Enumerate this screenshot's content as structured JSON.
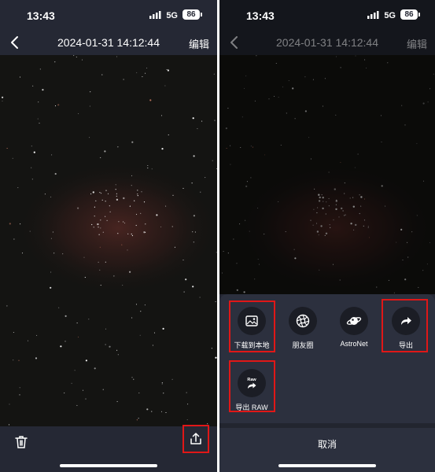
{
  "colors": {
    "background": "#252834",
    "sheet": "#2c303e",
    "highlight": "#e01717",
    "text": "#ffffff"
  },
  "status_bar": {
    "time": "13:43",
    "network": "5G",
    "battery": "86"
  },
  "nav": {
    "title": "2024-01-31 14:12:44",
    "edit_label": "编辑",
    "back_icon": "chevron-left-icon"
  },
  "bottom_bar": {
    "delete_icon": "trash-icon",
    "share_icon": "share-icon"
  },
  "share_sheet": {
    "options": [
      {
        "label": "下载到本地",
        "icon": "image-download-icon"
      },
      {
        "label": "朋友圈",
        "icon": "moments-icon"
      },
      {
        "label": "AstroNet",
        "icon": "planet-icon"
      },
      {
        "label": "导出",
        "icon": "share-arrow-icon"
      },
      {
        "label": "导出 RAW",
        "icon": "raw-export-icon"
      }
    ],
    "cancel_label": "取消"
  }
}
